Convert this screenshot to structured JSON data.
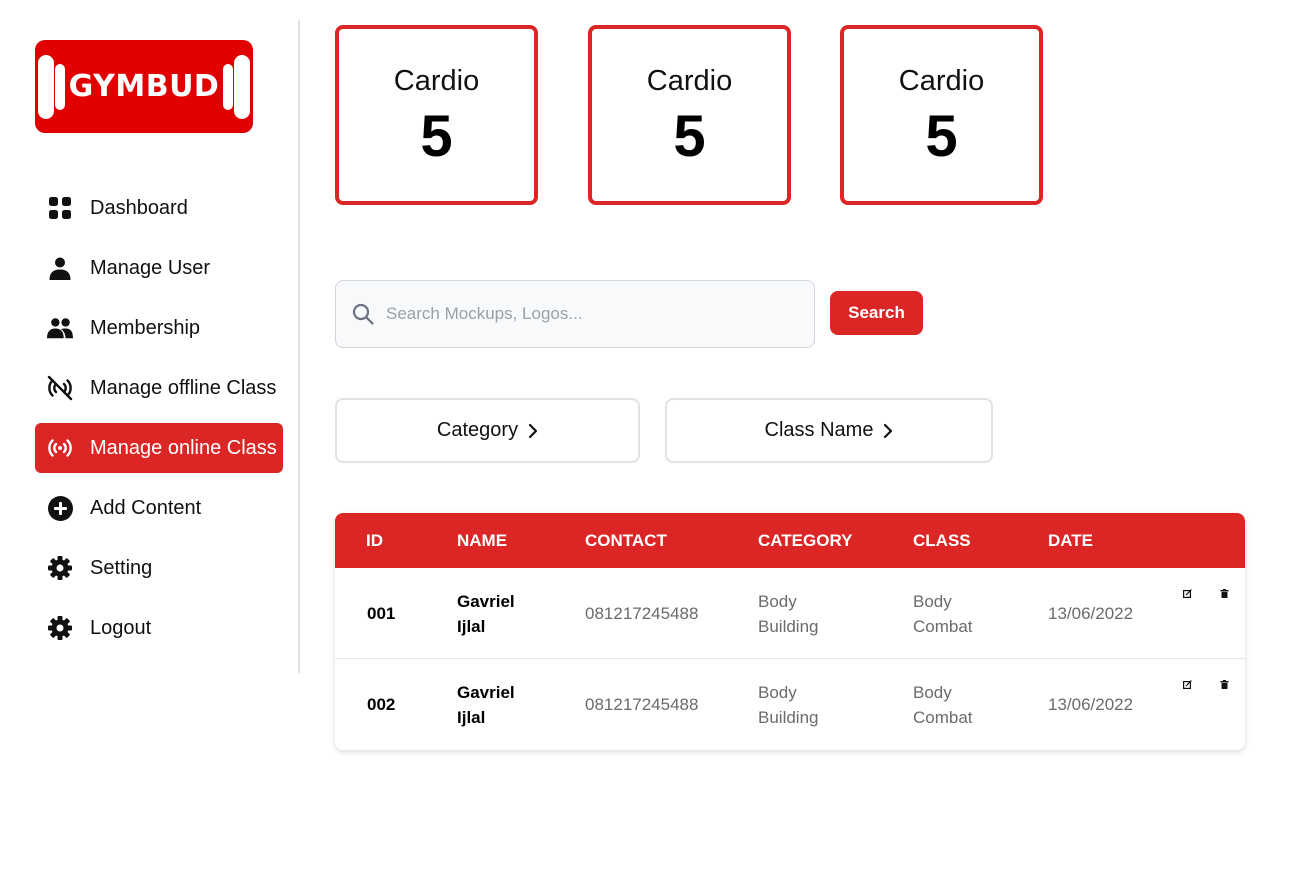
{
  "brand": {
    "logo_text": "GYMBUD"
  },
  "sidebar": {
    "items": [
      {
        "label": "Dashboard",
        "icon": "grid-icon",
        "active": false
      },
      {
        "label": "Manage User",
        "icon": "user-icon",
        "active": false
      },
      {
        "label": "Membership",
        "icon": "users-icon",
        "active": false
      },
      {
        "label": "Manage offline Class",
        "icon": "broadcast-off-icon",
        "active": false
      },
      {
        "label": "Manage online Class",
        "icon": "broadcast-icon",
        "active": true
      },
      {
        "label": "Add Content",
        "icon": "plus-circle-icon",
        "active": false
      },
      {
        "label": "Setting",
        "icon": "gear-icon",
        "active": false
      },
      {
        "label": "Logout",
        "icon": "gear-icon",
        "active": false
      }
    ]
  },
  "stats": [
    {
      "label": "Cardio",
      "value": "5"
    },
    {
      "label": "Cardio",
      "value": "5"
    },
    {
      "label": "Cardio",
      "value": "5"
    }
  ],
  "search": {
    "placeholder": "Search Mockups, Logos...",
    "button_label": "Search"
  },
  "filters": {
    "category_label": "Category",
    "class_name_label": "Class Name"
  },
  "table": {
    "columns": [
      "ID",
      "NAME",
      "CONTACT",
      "CATEGORY",
      "CLASS",
      "DATE"
    ],
    "rows": [
      {
        "id": "001",
        "name_first": "Gavriel",
        "name_last": "Ijlal",
        "contact": "081217245488",
        "category_1": "Body",
        "category_2": "Building",
        "class_1": "Body",
        "class_2": "Combat",
        "date": "13/06/2022"
      },
      {
        "id": "002",
        "name_first": "Gavriel",
        "name_last": "Ijlal",
        "contact": "081217245488",
        "category_1": "Body",
        "category_2": "Building",
        "class_1": "Body",
        "class_2": "Combat",
        "date": "13/06/2022"
      }
    ]
  },
  "colors": {
    "accent": "#dc2626",
    "logo_bg": "#e00000"
  }
}
